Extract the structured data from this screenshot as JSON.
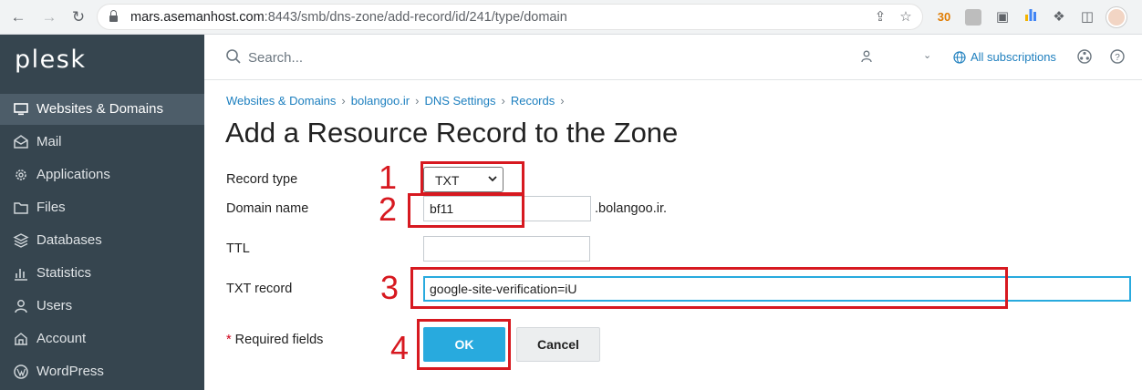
{
  "browser": {
    "url_host": "mars.asemanhost.com",
    "url_rest": ":8443/smb/dns-zone/add-record/id/241/type/domain"
  },
  "sidebar": {
    "logo": "plesk",
    "items": [
      {
        "label": "Websites & Domains",
        "icon": "monitor-icon",
        "active": true
      },
      {
        "label": "Mail",
        "icon": "mail-icon"
      },
      {
        "label": "Applications",
        "icon": "gear-icon"
      },
      {
        "label": "Files",
        "icon": "folder-icon"
      },
      {
        "label": "Databases",
        "icon": "database-icon"
      },
      {
        "label": "Statistics",
        "icon": "bar-chart-icon"
      },
      {
        "label": "Users",
        "icon": "user-icon"
      },
      {
        "label": "Account",
        "icon": "account-icon"
      },
      {
        "label": "WordPress",
        "icon": "wordpress-icon"
      }
    ]
  },
  "topbar": {
    "search_placeholder": "Search...",
    "subscriptions": "All subscriptions"
  },
  "breadcrumb": [
    "Websites & Domains",
    "bolangoo.ir",
    "DNS Settings",
    "Records"
  ],
  "page_title": "Add a Resource Record to the Zone",
  "form": {
    "record_type_label": "Record type",
    "record_type_value": "TXT",
    "domain_label": "Domain name",
    "domain_value": "bf11",
    "domain_suffix": ".bolangoo.ir.",
    "ttl_label": "TTL",
    "ttl_value": "",
    "txt_label": "TXT record",
    "txt_value": "google-site-verification=iU",
    "required_star": "*",
    "required_text": " Required fields",
    "ok_label": "OK",
    "cancel_label": "Cancel"
  },
  "annotations": [
    "1",
    "2",
    "3",
    "4"
  ],
  "colors": {
    "accent": "#28aade",
    "sidebar": "#36454f",
    "annotation": "#d71920",
    "link": "#1c7fbf"
  }
}
